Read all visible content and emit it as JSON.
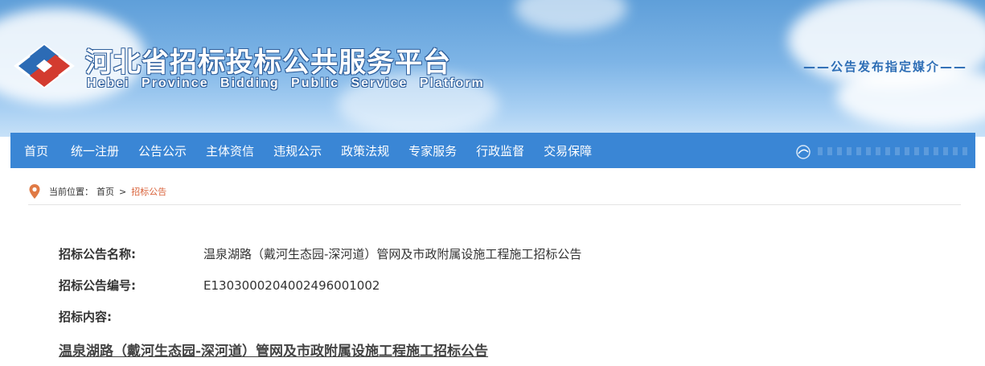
{
  "header": {
    "title_cn": "河北省招标投标公共服务平台",
    "title_en": "Hebei Province Bidding Public Service Platform",
    "slogan": "——公告发布指定媒介——",
    "icon": "hebei-logo-icon"
  },
  "nav": {
    "items": [
      {
        "label": "首页"
      },
      {
        "label": "统一注册"
      },
      {
        "label": "公告公示"
      },
      {
        "label": "主体资信"
      },
      {
        "label": "违规公示"
      },
      {
        "label": "政策法规"
      },
      {
        "label": "专家服务"
      },
      {
        "label": "行政监督"
      },
      {
        "label": "交易保障"
      }
    ],
    "background": "#3a86d5"
  },
  "breadcrumb": {
    "prefix": "当前位置：",
    "home": "首页",
    "separator": ">",
    "current": "招标公告",
    "active_color": "#d9623a"
  },
  "notice": {
    "name_label": "招标公告名称:",
    "name_value": "温泉湖路（戴河生态园-深河道）管网及市政附属设施工程施工招标公告",
    "code_label": "招标公告编号:",
    "code_value": "E1303000204002496001002",
    "content_label": "招标内容:",
    "content_title": "温泉湖路（戴河生态园-深河道）管网及市政附属设施工程施工招标公告"
  }
}
